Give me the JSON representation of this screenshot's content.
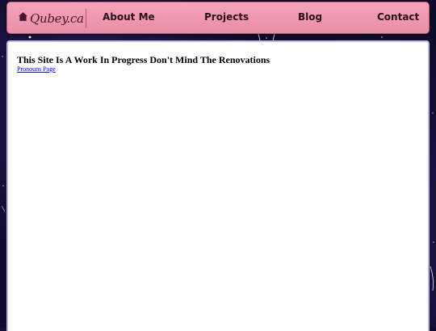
{
  "header": {
    "logo_text": "Qubey.ca",
    "logo_icon": "house-icon",
    "nav": [
      {
        "label": "About Me"
      },
      {
        "label": "Projects"
      },
      {
        "label": "Blog"
      },
      {
        "label": "Contact"
      }
    ]
  },
  "main": {
    "title": "This Site Is A Work In Progress Don't Mind The Renovations",
    "link_text": "Pronouns Page"
  },
  "colors": {
    "navbar": "#e98ea7",
    "background": "#0f0b2a",
    "content_border": "#b9b4e8"
  }
}
